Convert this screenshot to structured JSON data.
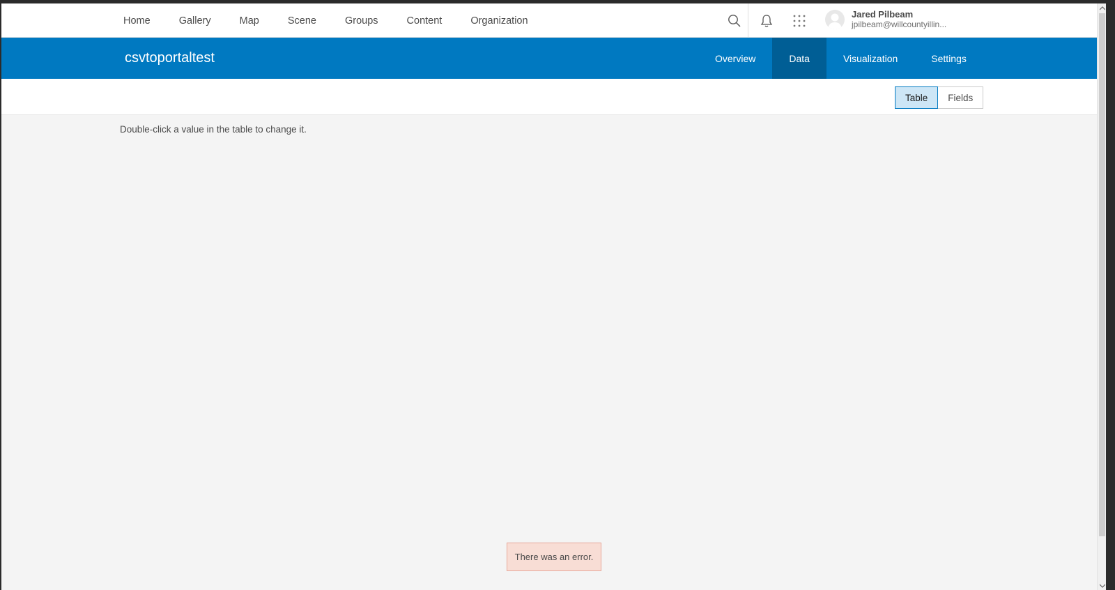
{
  "topnav": {
    "links": [
      "Home",
      "Gallery",
      "Map",
      "Scene",
      "Groups",
      "Content",
      "Organization"
    ],
    "icons": [
      "search-icon",
      "bell-icon",
      "apps-grid-icon"
    ],
    "user": {
      "name": "Jared Pilbeam",
      "email": "jpilbeam@willcountyillin..."
    }
  },
  "item": {
    "title": "csvtoportaltest",
    "tabs": [
      {
        "label": "Overview",
        "active": false
      },
      {
        "label": "Data",
        "active": true
      },
      {
        "label": "Visualization",
        "active": false
      },
      {
        "label": "Settings",
        "active": false
      }
    ]
  },
  "toolbar": {
    "view_toggle": [
      {
        "label": "Table",
        "active": true
      },
      {
        "label": "Fields",
        "active": false
      }
    ]
  },
  "main": {
    "hint": "Double-click a value in the table to change it."
  },
  "toast": {
    "message": "There was an error."
  },
  "colors": {
    "brand_blue": "#0079c1",
    "active_tab": "#005e95",
    "error_bg": "#f8ddd5"
  }
}
